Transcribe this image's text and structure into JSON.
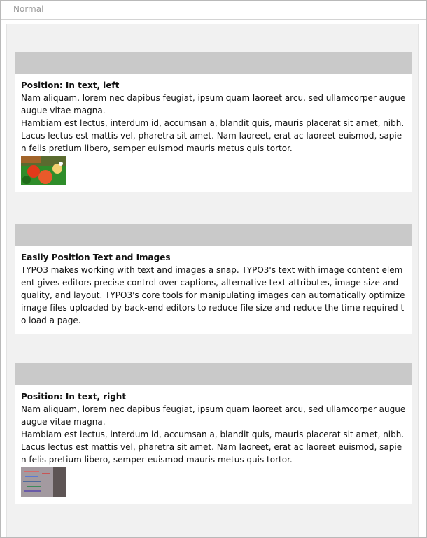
{
  "column": {
    "label": "Normal"
  },
  "elements": [
    {
      "title": "Position: In text, left",
      "paragraphs": [
        "Nam aliquam, lorem nec dapibus feugiat, ipsum quam laoreet arcu, sed ullamcorper augue augue vitae magna.",
        "Hambiam est lectus, interdum id, accumsan a, blandit quis, mauris placerat sit amet, nibh. Lacus lectus est mattis vel, pharetra sit amet. Nam laoreet, erat ac laoreet euismod, sapien felis pretium libero, semper euismod mauris metus quis tortor."
      ],
      "image": "billiard-balls-thumbnail"
    },
    {
      "title": "Easily Position Text and Images",
      "paragraphs": [
        "TYPO3 makes working with text and images a snap. TYPO3's text with image content element gives editors precise control over captions, alternative text attributes, image size and quality, and layout. TYPO3's core tools for manipulating images can automatically optimize image files uploaded by back-end editors to reduce file size and reduce the time required to load a page."
      ]
    },
    {
      "title": "Position: In text, right",
      "paragraphs": [
        "Nam aliquam, lorem nec dapibus feugiat, ipsum quam laoreet arcu, sed ullamcorper augue augue vitae magna.",
        "Hambiam est lectus, interdum id, accumsan a, blandit quis, mauris placerat sit amet, nibh. Lacus lectus est mattis vel, pharetra sit amet. Nam laoreet, erat ac laoreet euismod, sapien felis pretium libero, semper euismod mauris metus quis tortor."
      ],
      "image": "whiteboard-thumbnail"
    }
  ],
  "colors": {
    "column_background": "#f1f1f1",
    "element_header": "#c9c9c9",
    "label_text": "#9a9a9a"
  }
}
